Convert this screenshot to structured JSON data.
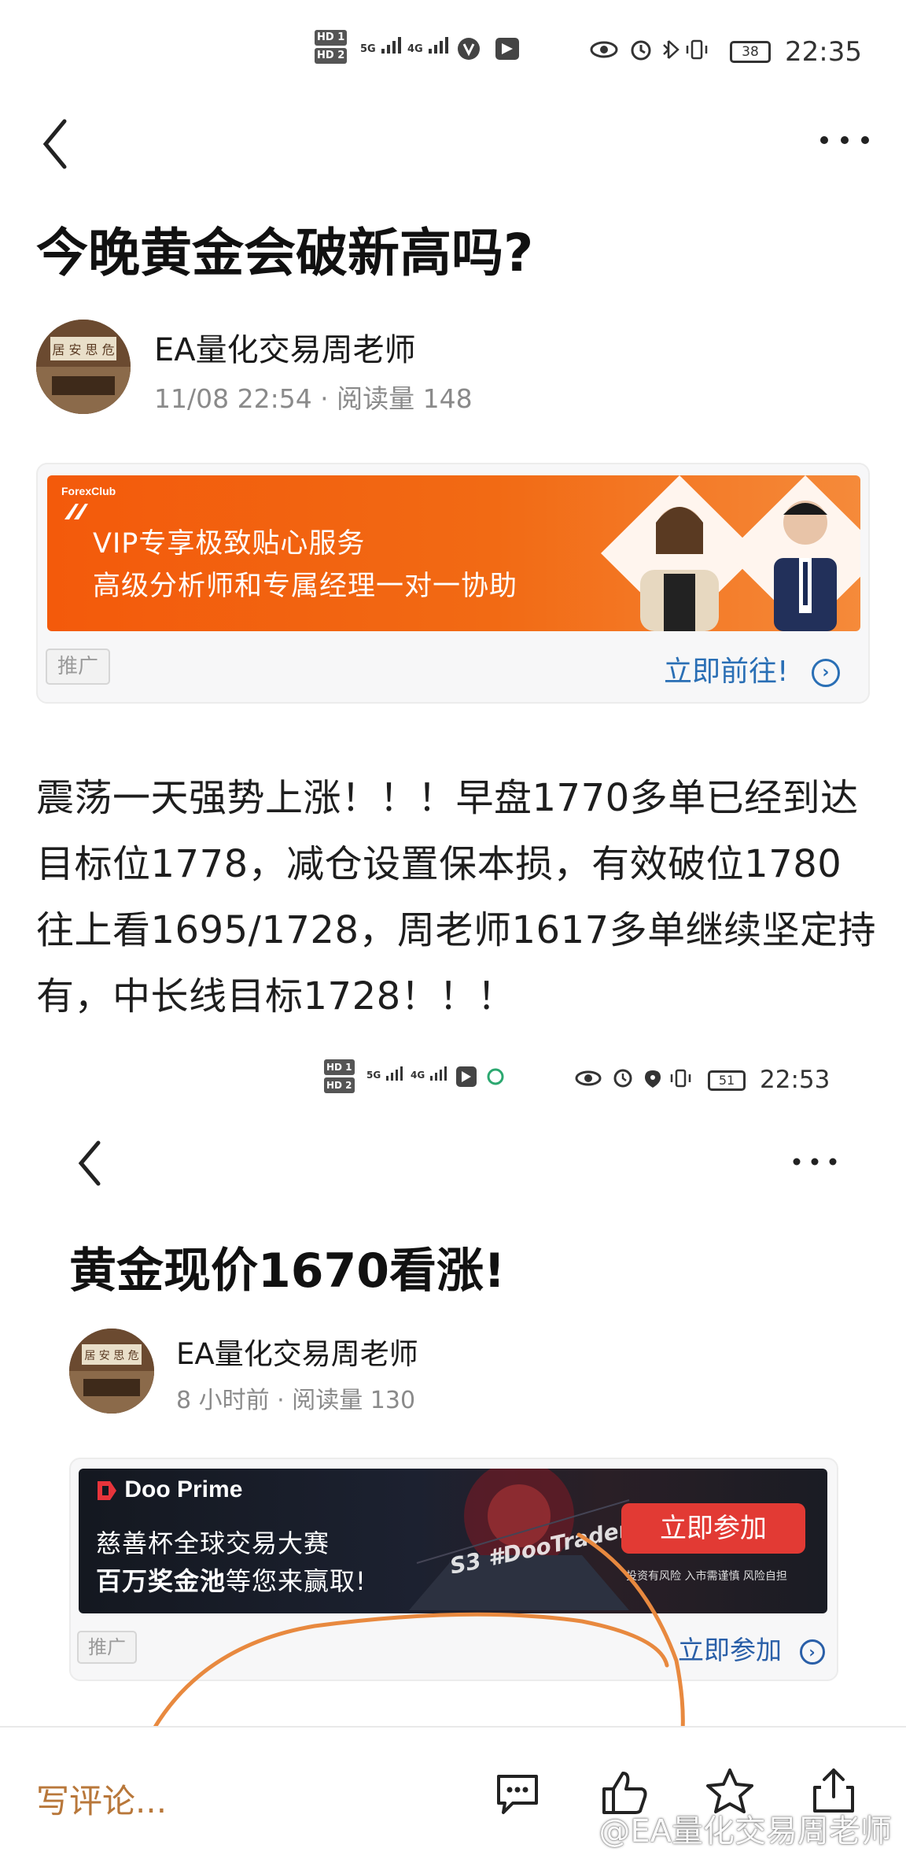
{
  "screenshot1": {
    "status": {
      "hd1": "HD 1",
      "hd2": "HD 2",
      "net1": "5G",
      "net2": "4G",
      "battery": "38",
      "time": "22:35"
    },
    "title": "今晚黄金会破新高吗?",
    "author": "EA量化交易周老师",
    "meta": "11/08 22:54 · 阅读量 148",
    "ad": {
      "brand": "ForexClub",
      "line1": "VIP专享极致贴心服务",
      "line2": "高级分析师和专属经理一对一协助",
      "tag": "推广",
      "cta": "立即前往!"
    },
    "body": "震荡一天强势上涨！！！早盘1770多单已经到达目标位1778，减仓设置保本损，有效破位1780往上看1695/1728，周老师1617多单继续坚定持有，中长线目标1728！！！"
  },
  "screenshot2": {
    "status": {
      "hd1": "HD 1",
      "hd2": "HD 2",
      "net1": "5G",
      "net2": "4G",
      "battery": "51",
      "time": "22:53"
    },
    "title": "黄金现价1670看涨!",
    "author": "EA量化交易周老师",
    "meta": "8 小时前 · 阅读量 130",
    "ad": {
      "brand": "Doo Prime",
      "line1": "慈善杯全球交易大赛",
      "line2a": "百万奖金池",
      "line2b": "等您来赢取!",
      "button": "立即参加",
      "overlay": "S3 #DooTrader",
      "disclaimer": "投资有风险 入市需谨慎 风险自担",
      "tag": "推广",
      "cta": "立即参加"
    }
  },
  "bottom": {
    "comment_placeholder": "写评论...",
    "watermark": "@EA量化交易周老师"
  },
  "colors": {
    "orange_banner": "#f26a14",
    "cta_blue": "#2a6fb5",
    "annotation_orange": "#e8893f",
    "comment_brown": "#b8773a"
  }
}
